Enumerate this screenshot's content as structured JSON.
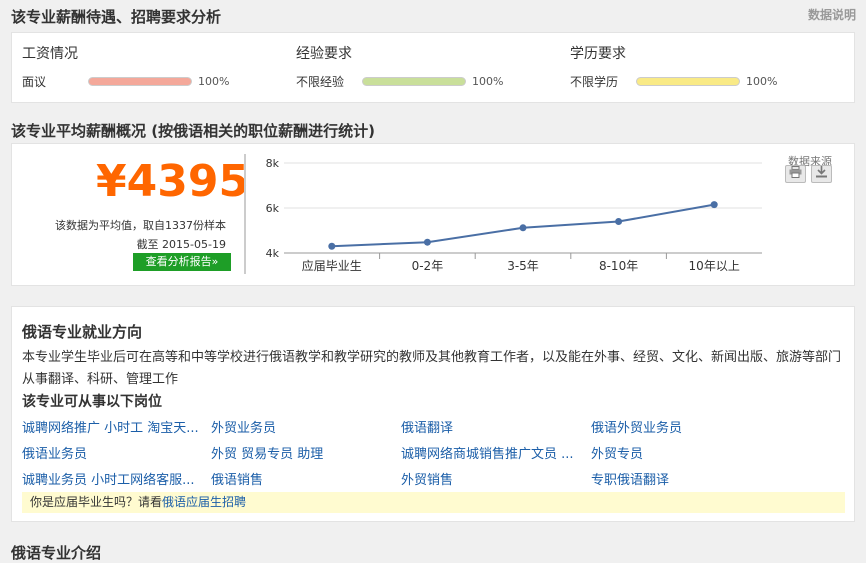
{
  "section1": {
    "title": "该专业薪酬待遇、招聘要求分析",
    "help": "数据说明",
    "cols": [
      {
        "label": "工资情况",
        "item": "面议",
        "pct": "100%",
        "value": 1.0,
        "color": "#f4a89a"
      },
      {
        "label": "经验要求",
        "item": "不限经验",
        "pct": "100%",
        "value": 1.0,
        "color": "#c9df9a"
      },
      {
        "label": "学历要求",
        "item": "不限学历",
        "pct": "100%",
        "value": 1.0,
        "color": "#f9ea86"
      }
    ]
  },
  "section2": {
    "title": "该专业平均薪酬概况 (按俄语相关的职位薪酬进行统计)",
    "salary": "¥4395",
    "sample_text": "该数据为平均值，取自1337份样本",
    "date_text": "截至 2015-05-19",
    "report_btn": "查看分析报告»",
    "source_label": "数据来源",
    "print_icon": "printer-icon",
    "download_icon": "download-icon"
  },
  "chart_data": {
    "type": "line",
    "categories": [
      "应届毕业生",
      "0-2年",
      "3-5年",
      "8-10年",
      "10年以上"
    ],
    "values": [
      4300,
      4480,
      5120,
      5400,
      6150
    ],
    "yticks": [
      "8k",
      "6k",
      "4k"
    ],
    "ylim": [
      4000,
      8000
    ],
    "grid": true,
    "line_color": "#4a6fa5"
  },
  "section3": {
    "title": "俄语专业就业方向",
    "desc": "本专业学生毕业后可在高等和中等学校进行俄语教学和教学研究的教师及其他教育工作者，以及能在外事、经贸、文化、新闻出版、旅游等部门从事翻译、科研、管理工作",
    "subtitle": "该专业可从事以下岗位",
    "jobs": [
      "诚聘网络推广 小时工 淘宝天...",
      "外贸业务员",
      "俄语翻译",
      "俄语外贸业务员",
      "俄语业务员",
      "外贸 贸易专员 助理",
      "诚聘网络商城销售推广文员 ...",
      "外贸专员",
      "诚聘业务员 小时工网络客服...",
      "俄语销售",
      "外贸销售",
      "专职俄语翻译"
    ],
    "tip_prefix": "你是应届毕业生吗？请看",
    "tip_link": "俄语应届生招聘"
  },
  "section4": {
    "title": "俄语专业介绍"
  }
}
